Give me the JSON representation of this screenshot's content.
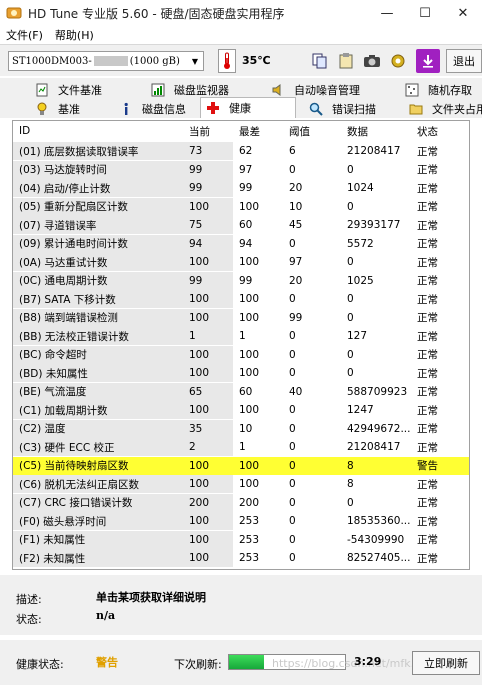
{
  "window": {
    "title": "HD Tune 专业版 5.60 - 硬盘/固态硬盘实用程序",
    "minimize": "—",
    "maximize": "☐",
    "close": "✕"
  },
  "menu": {
    "file": "文件(F)",
    "help": "帮助(H)"
  },
  "toolbar": {
    "drive_prefix": "ST1000DM003-",
    "drive_suffix": "(1000 gB)",
    "temperature": "35℃",
    "exit": "退出"
  },
  "tabs": {
    "row1": [
      {
        "label": "文件基准",
        "icon": "file-benchmark-icon"
      },
      {
        "label": "磁盘监视器",
        "icon": "disk-monitor-icon"
      },
      {
        "label": "自动噪音管理",
        "icon": "speaker-icon"
      },
      {
        "label": "随机存取",
        "icon": "random-access-icon"
      }
    ],
    "row2": [
      {
        "label": "基准",
        "icon": "benchmark-icon"
      },
      {
        "label": "磁盘信息",
        "icon": "info-icon"
      },
      {
        "label": "健康",
        "icon": "health-cross-icon"
      },
      {
        "label": "错误扫描",
        "icon": "magnifier-icon"
      },
      {
        "label": "文件夹占用",
        "icon": "folder-icon"
      }
    ],
    "active": "健康"
  },
  "table": {
    "headers": [
      "ID",
      "当前",
      "最差",
      "阈值",
      "数据",
      "状态"
    ],
    "rows": [
      {
        "id": "(01) 底层数据读取错误率",
        "cur": "73",
        "worst": "62",
        "thr": "6",
        "raw": "21208417",
        "status": "正常"
      },
      {
        "id": "(03) 马达旋转时间",
        "cur": "99",
        "worst": "97",
        "thr": "0",
        "raw": "0",
        "status": "正常"
      },
      {
        "id": "(04) 启动/停止计数",
        "cur": "99",
        "worst": "99",
        "thr": "20",
        "raw": "1024",
        "status": "正常"
      },
      {
        "id": "(05) 重新分配扇区计数",
        "cur": "100",
        "worst": "100",
        "thr": "10",
        "raw": "0",
        "status": "正常"
      },
      {
        "id": "(07) 寻道错误率",
        "cur": "75",
        "worst": "60",
        "thr": "45",
        "raw": "29393177",
        "status": "正常"
      },
      {
        "id": "(09) 累计通电时间计数",
        "cur": "94",
        "worst": "94",
        "thr": "0",
        "raw": "5572",
        "status": "正常"
      },
      {
        "id": "(0A) 马达重试计数",
        "cur": "100",
        "worst": "100",
        "thr": "97",
        "raw": "0",
        "status": "正常"
      },
      {
        "id": "(0C) 通电周期计数",
        "cur": "99",
        "worst": "99",
        "thr": "20",
        "raw": "1025",
        "status": "正常"
      },
      {
        "id": "(B7) SATA 下移计数",
        "cur": "100",
        "worst": "100",
        "thr": "0",
        "raw": "0",
        "status": "正常"
      },
      {
        "id": "(B8) 端到端错误检测",
        "cur": "100",
        "worst": "100",
        "thr": "99",
        "raw": "0",
        "status": "正常"
      },
      {
        "id": "(BB) 无法校正错误计数",
        "cur": "1",
        "worst": "1",
        "thr": "0",
        "raw": "127",
        "status": "正常"
      },
      {
        "id": "(BC) 命令超时",
        "cur": "100",
        "worst": "100",
        "thr": "0",
        "raw": "0",
        "status": "正常"
      },
      {
        "id": "(BD) 未知属性",
        "cur": "100",
        "worst": "100",
        "thr": "0",
        "raw": "0",
        "status": "正常"
      },
      {
        "id": "(BE) 气流温度",
        "cur": "65",
        "worst": "60",
        "thr": "40",
        "raw": "588709923",
        "status": "正常"
      },
      {
        "id": "(C1) 加载周期计数",
        "cur": "100",
        "worst": "100",
        "thr": "0",
        "raw": "1247",
        "status": "正常"
      },
      {
        "id": "(C2) 温度",
        "cur": "35",
        "worst": "10",
        "thr": "0",
        "raw": "42949672...",
        "status": "正常"
      },
      {
        "id": "(C3) 硬件 ECC 校正",
        "cur": "2",
        "worst": "1",
        "thr": "0",
        "raw": "21208417",
        "status": "正常"
      },
      {
        "id": "(C5) 当前待映射扇区数",
        "cur": "100",
        "worst": "100",
        "thr": "0",
        "raw": "8",
        "status": "警告"
      },
      {
        "id": "(C6) 脱机无法纠正扇区数",
        "cur": "100",
        "worst": "100",
        "thr": "0",
        "raw": "8",
        "status": "正常"
      },
      {
        "id": "(C7) CRC 接口错误计数",
        "cur": "200",
        "worst": "200",
        "thr": "0",
        "raw": "0",
        "status": "正常"
      },
      {
        "id": "(F0) 磁头悬浮时间",
        "cur": "100",
        "worst": "253",
        "thr": "0",
        "raw": "18535360...",
        "status": "正常"
      },
      {
        "id": "(F1) 未知属性",
        "cur": "100",
        "worst": "253",
        "thr": "0",
        "raw": "-54309990",
        "status": "正常"
      },
      {
        "id": "(F2) 未知属性",
        "cur": "100",
        "worst": "253",
        "thr": "0",
        "raw": "82527405...",
        "status": "正常"
      }
    ]
  },
  "details": {
    "desc_label": "描述:",
    "desc_value": "单击某项获取详细说明",
    "status_label": "状态:",
    "status_value": "n/a"
  },
  "statusbar": {
    "health_label": "健康状态:",
    "health_value": "警告",
    "next_refresh_label": "下次刷新:",
    "progress": 0.3,
    "countdown": "3:29",
    "refresh_button": "立即刷新",
    "watermark": "https://blog.csdn.net/mfk...",
    "health_color": "#e0a000"
  }
}
